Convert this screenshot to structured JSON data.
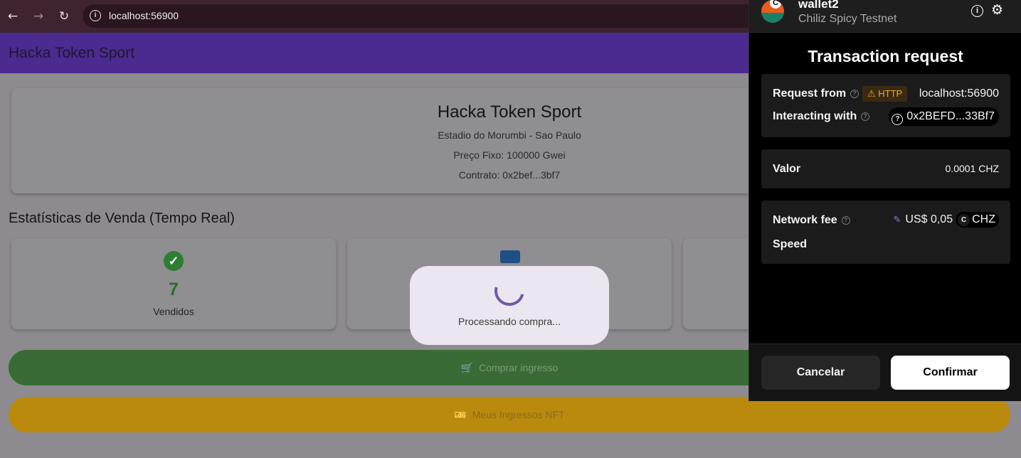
{
  "browser": {
    "url": "localhost:56900"
  },
  "app": {
    "title": "Hacka Token Sport"
  },
  "event": {
    "title": "Hacka Token Sport",
    "venue": "Estadio do Morumbi - Sao Paulo",
    "price": "Preço Fixo: 100000 Gwei",
    "contract": "Contrato: 0x2bef...3bf7"
  },
  "stats": {
    "title": "Estatísticas de Venda (Tempo Real)",
    "cards": [
      {
        "value": "7",
        "label": "Vendidos",
        "icon": "check-circle-icon"
      },
      {
        "icon": "inventory-icon"
      },
      {}
    ]
  },
  "actions": {
    "buy_label": "Comprar ingresso",
    "nft_label": "Meus Ingressos NFT"
  },
  "processing": {
    "text": "Processando compra..."
  },
  "wallet": {
    "account_name": "wallet2",
    "network": "Chiliz Spicy Testnet",
    "heading": "Transaction request",
    "request_from_label": "Request from",
    "http_badge": "HTTP",
    "request_origin": "localhost:56900",
    "interacting_label": "Interacting with",
    "contract_address": "0x2BEFD...33Bf7",
    "value_label": "Valor",
    "value_amount": "0.0001 CHZ",
    "fee_label": "Network fee",
    "fee_amount": "US$ 0,05",
    "fee_token": "CHZ",
    "speed_label": "Speed",
    "cancel_label": "Cancelar",
    "confirm_label": "Confirmar"
  },
  "colors": {
    "header": "#4b2b8f",
    "buy_button": "#3a6b36",
    "nft_button": "#b98a0d",
    "success": "#2e7d32",
    "wallet_bg": "#000000"
  }
}
